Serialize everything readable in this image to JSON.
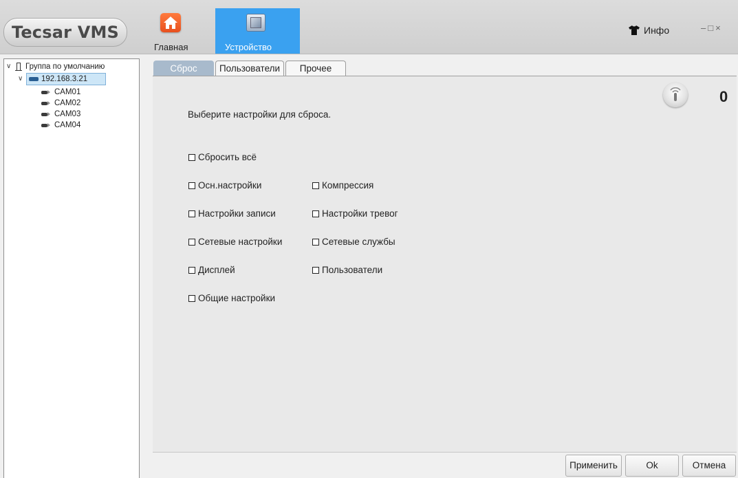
{
  "app": {
    "logo": "Tecsar VMS"
  },
  "nav": {
    "home_label": "Главная",
    "device_label": "Устройство",
    "info_label": "Инфо",
    "window_controls": {
      "minimize": "–",
      "maximize": "□",
      "close": "×"
    },
    "active_color": "#3aa1f0"
  },
  "tree": {
    "group": "Группа по умолчанию",
    "device": "192.168.3.21",
    "cameras": [
      "CAM01",
      "CAM02",
      "CAM03",
      "CAM04"
    ]
  },
  "tabs": [
    "Сброс",
    "Пользователи",
    "Прочее"
  ],
  "reset": {
    "intro": "Выберите настройки для сброса.",
    "reset_all": "Сбросить всё",
    "left_options": [
      "Осн.настройки",
      "Настройки записи",
      "Сетевые настройки",
      "Дисплей",
      "Общие настройки"
    ],
    "right_options": [
      "Компрессия",
      "Настройки тревог",
      "Сетевые службы",
      "Пользователи"
    ]
  },
  "alarm": {
    "icon": "alarm-speaker-icon",
    "count": "0"
  },
  "buttons": {
    "apply": "Применить",
    "ok": "Ok",
    "cancel": "Отмена"
  }
}
